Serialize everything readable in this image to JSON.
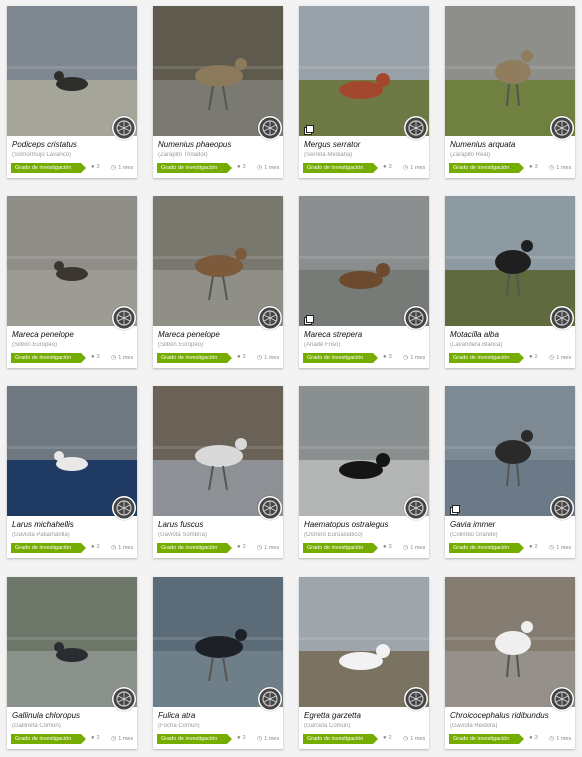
{
  "observations": [
    {
      "scientific_name": "Podiceps cristatus",
      "common_name": "(Somormujo Lavanco)",
      "quality": "Grado de investigación",
      "identifications": "2",
      "time_ago": "1 mes",
      "multi_photo": false,
      "photo": {
        "sky": "#7f8790",
        "ground": "#a6a59a",
        "subject": "#2d2d2a"
      }
    },
    {
      "scientific_name": "Numenius phaeopus",
      "common_name": "(Zarapito Trinador)",
      "quality": "Grado de investigación",
      "identifications": "3",
      "time_ago": "1 mes",
      "multi_photo": false,
      "photo": {
        "sky": "#5e5a4d",
        "ground": "#7a7a73",
        "subject": "#8b7a5c"
      }
    },
    {
      "scientific_name": "Mergus serrator",
      "common_name": "(Serreta Mediana)",
      "quality": "Grado de investigación",
      "identifications": "3",
      "time_ago": "1 mes",
      "multi_photo": true,
      "photo": {
        "sky": "#9aa2a9",
        "ground": "#6e7a45",
        "subject": "#a3482f"
      }
    },
    {
      "scientific_name": "Numenius arquata",
      "common_name": "(Zarapito Real)",
      "quality": "Grado de investigación",
      "identifications": "3",
      "time_ago": "1 mes",
      "multi_photo": false,
      "photo": {
        "sky": "#8e8f8b",
        "ground": "#6f8040",
        "subject": "#8f7d5d"
      }
    },
    {
      "scientific_name": "Mareca penelope",
      "common_name": "(Silbón Europeo)",
      "quality": "Grado de investigación",
      "identifications": "3",
      "time_ago": "1 mes",
      "multi_photo": false,
      "photo": {
        "sky": "#8e8d88",
        "ground": "#9c9b94",
        "subject": "#3a3530"
      }
    },
    {
      "scientific_name": "Mareca penelope",
      "common_name": "(Silbón Europeo)",
      "quality": "Grado de investigación",
      "identifications": "3",
      "time_ago": "1 mes",
      "multi_photo": false,
      "photo": {
        "sky": "#79786f",
        "ground": "#8f8f88",
        "subject": "#7d5a3c"
      }
    },
    {
      "scientific_name": "Mareca strepera",
      "common_name": "(Ánade Friso)",
      "quality": "Grado de investigación",
      "identifications": "3",
      "time_ago": "1 mes",
      "multi_photo": true,
      "photo": {
        "sky": "#8a8e8e",
        "ground": "#777b78",
        "subject": "#6b4a2d"
      }
    },
    {
      "scientific_name": "Motacilla alba",
      "common_name": "(Lavandera Blanca)",
      "quality": "Grado de investigación",
      "identifications": "2",
      "time_ago": "1 mes",
      "multi_photo": false,
      "photo": {
        "sky": "#8d9aa1",
        "ground": "#5f6a3e",
        "subject": "#1f1f1f"
      }
    },
    {
      "scientific_name": "Larus michahellis",
      "common_name": "(Gaviota Patiamarilla)",
      "quality": "Grado de investigación",
      "identifications": "2",
      "time_ago": "1 mes",
      "multi_photo": false,
      "photo": {
        "sky": "#6f7880",
        "ground": "#1f3b63",
        "subject": "#e8e8e8"
      }
    },
    {
      "scientific_name": "Larus fuscus",
      "common_name": "(Gaviota Sombría)",
      "quality": "Grado de investigación",
      "identifications": "2",
      "time_ago": "1 mes",
      "multi_photo": false,
      "photo": {
        "sky": "#6a6257",
        "ground": "#8d9195",
        "subject": "#d9d9d9"
      }
    },
    {
      "scientific_name": "Haematopus ostralegus",
      "common_name": "(Ostrero Euroasiático)",
      "quality": "Grado de investigación",
      "identifications": "3",
      "time_ago": "1 mes",
      "multi_photo": false,
      "photo": {
        "sky": "#8a8f8f",
        "ground": "#b2b5b3",
        "subject": "#151515"
      }
    },
    {
      "scientific_name": "Gavia immer",
      "common_name": "(Colimbo Grande)",
      "quality": "Grado de investigación",
      "identifications": "2",
      "time_ago": "1 mes",
      "multi_photo": true,
      "photo": {
        "sky": "#7d8a94",
        "ground": "#6b7a86",
        "subject": "#2a2a2a"
      }
    },
    {
      "scientific_name": "Gallinula chloropus",
      "common_name": "(Gallineta Común)",
      "quality": "Grado de investigación",
      "identifications": "2",
      "time_ago": "1 mes",
      "multi_photo": false,
      "photo": {
        "sky": "#6f776b",
        "ground": "#8b918b",
        "subject": "#2b2b32"
      }
    },
    {
      "scientific_name": "Fulica atra",
      "common_name": "(Focha Común)",
      "quality": "Grado de investigación",
      "identifications": "2",
      "time_ago": "1 mes",
      "multi_photo": false,
      "photo": {
        "sky": "#5b6c78",
        "ground": "#6f7f89",
        "subject": "#1e2028"
      }
    },
    {
      "scientific_name": "Egretta garzetta",
      "common_name": "(Garceta Común)",
      "quality": "Grado de investigación",
      "identifications": "2",
      "time_ago": "1 mes",
      "multi_photo": false,
      "photo": {
        "sky": "#9fa6ab",
        "ground": "#7a7362",
        "subject": "#f2f2f2"
      }
    },
    {
      "scientific_name": "Chroicocephalus ridibundus",
      "common_name": "(Gaviota Reidora)",
      "quality": "Grado de investigación",
      "identifications": "3",
      "time_ago": "1 mes",
      "multi_photo": false,
      "photo": {
        "sky": "#857d72",
        "ground": "#96908a",
        "subject": "#efefef"
      }
    }
  ],
  "colors": {
    "badge": "#74ac00",
    "card": "#ffffff",
    "background": "#f3f3f3"
  },
  "icons": {
    "identifications": "id-agree-icon",
    "time": "clock-icon",
    "multiple_photos": "multiple-photos-icon",
    "observer": "observer-avatar-icon"
  }
}
